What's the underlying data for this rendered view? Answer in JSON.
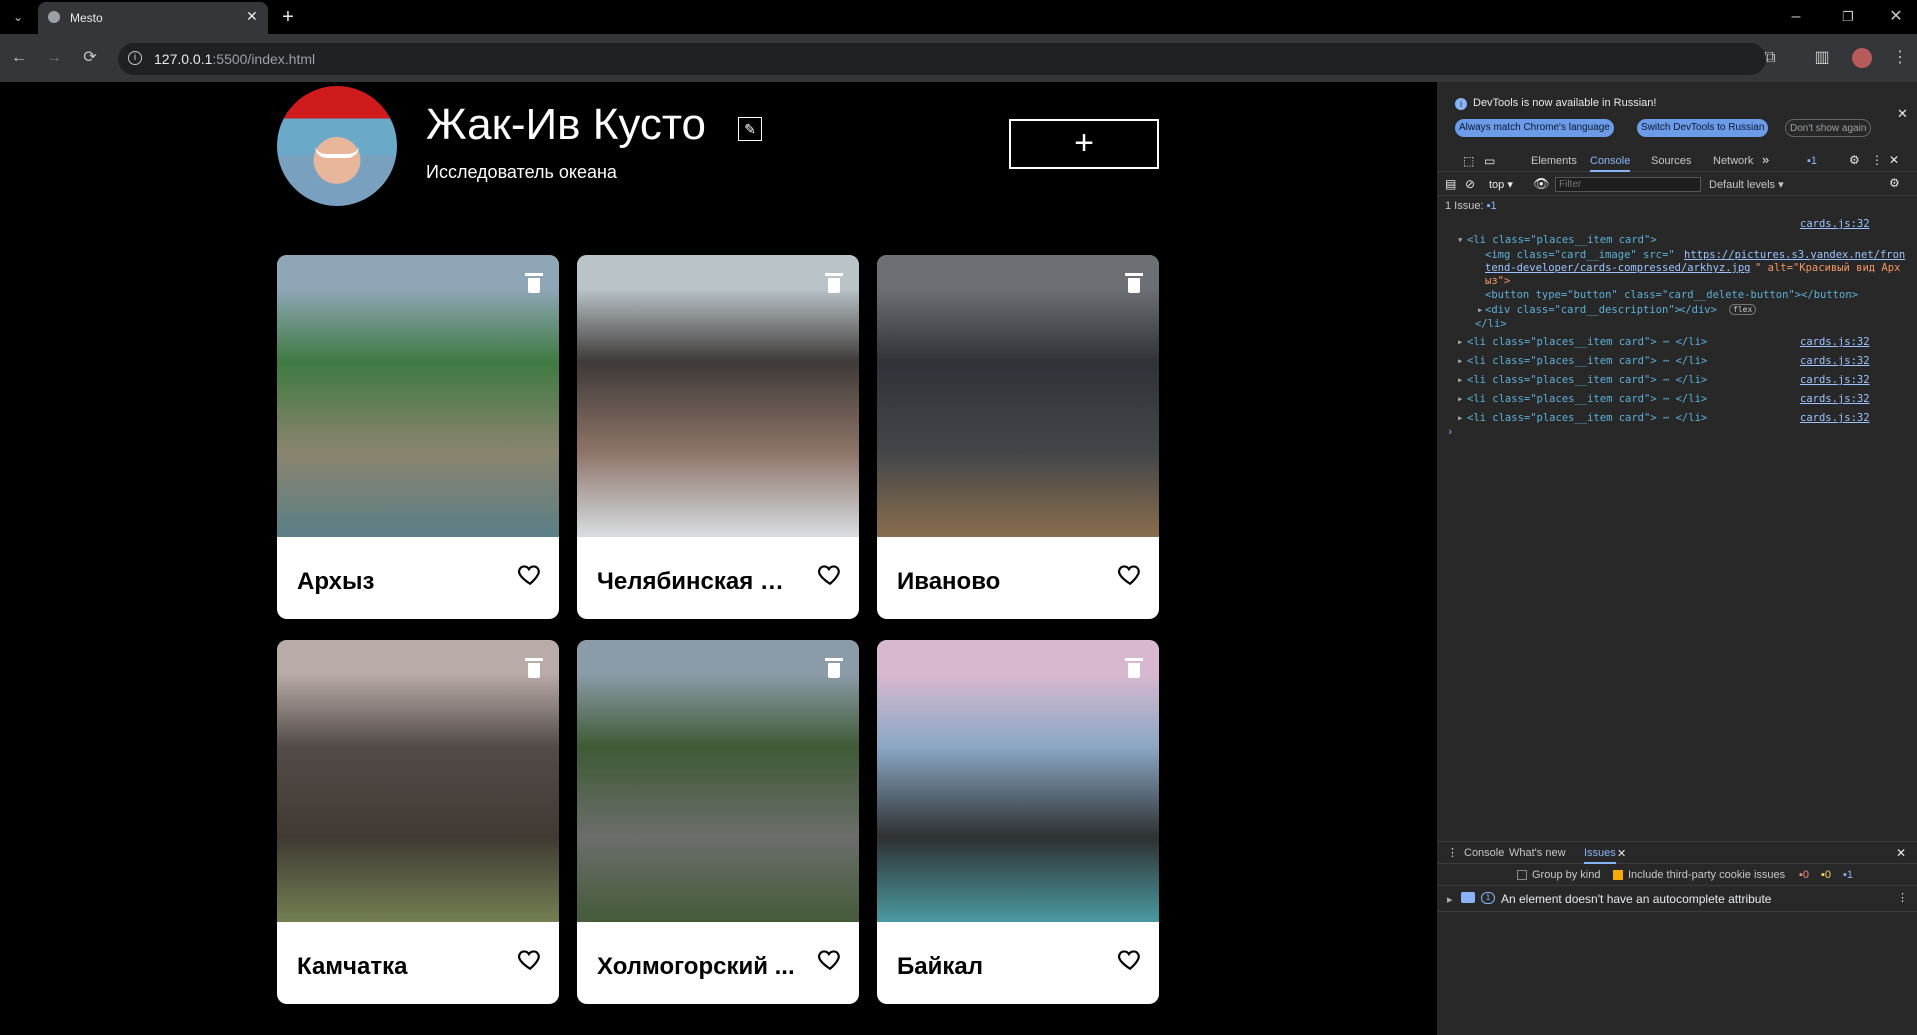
{
  "browser": {
    "tab_title": "Mesto",
    "url_host": "127.0.0.1",
    "url_path": ":5500/index.html"
  },
  "profile": {
    "name": "Жак-Ив Кусто",
    "about": "Исследователь океана",
    "add_symbol": "+",
    "edit_symbol": "✎"
  },
  "cards": [
    {
      "title": "Архыз",
      "colors": [
        "#8fa6b7",
        "#3f7a42",
        "#8b846e",
        "#5b7f88"
      ]
    },
    {
      "title": "Челябинская об...",
      "colors": [
        "#b9c3c8",
        "#3e3a38",
        "#8e7468",
        "#d8dde2"
      ]
    },
    {
      "title": "Иваново",
      "colors": [
        "#6c6f73",
        "#2f3338",
        "#434649",
        "#8a6d4c"
      ]
    },
    {
      "title": "Камчатка",
      "colors": [
        "#b9aba7",
        "#524b48",
        "#403a33",
        "#738052"
      ]
    },
    {
      "title": "Холмогорский ...",
      "colors": [
        "#8c9ba8",
        "#3f5a35",
        "#6b6e6b",
        "#455b3a"
      ]
    },
    {
      "title": "Байкал",
      "colors": [
        "#d8b8cf",
        "#8aa7c4",
        "#2e3132",
        "#4a9aa0"
      ]
    }
  ],
  "devtools": {
    "banner": "DevTools is now available in Russian!",
    "banner_btn1": "Always match Chrome's language",
    "banner_btn2": "Switch DevTools to Russian",
    "banner_btn3": "Don't show again",
    "tabs": [
      "Elements",
      "Console",
      "Sources",
      "Network"
    ],
    "issue_count": "1",
    "context": "top",
    "filter_placeholder": "Filter",
    "levels": "Default levels ▾",
    "issues_line": "1 Issue:",
    "issues_num": "1",
    "source_link": "cards.js:32",
    "log_open": "<li class=\"places__item card\">",
    "img_line_a": "<img class=\"card__image\" src=\"",
    "img_url_1": "https://pictures.s3.yandex.net/fron",
    "img_url_2": "tend-developer/cards-compressed/arkhyz.jpg",
    "img_alt": "\" alt=\"Красивый вид Арх",
    "img_alt2": "ыз\">",
    "button_line": "<button type=\"button\" class=\"card__delete-button\"></button>",
    "div_line": "<div class=\"card__description\">",
    "div_close": "</div>",
    "flex_badge": "flex",
    "li_close": "</li>",
    "collapsed_line": "<li class=\"places__item card\"> ⋯ </li>",
    "prompt": "›",
    "drawer_tabs": [
      "Console",
      "What's new",
      "Issues"
    ],
    "group_by_kind": "Group by kind",
    "third_party": "Include third-party cookie issues",
    "counts": [
      "0",
      "0",
      "1"
    ],
    "issue_badge": "1",
    "issue_text": "An element doesn't have an autocomplete attribute"
  }
}
